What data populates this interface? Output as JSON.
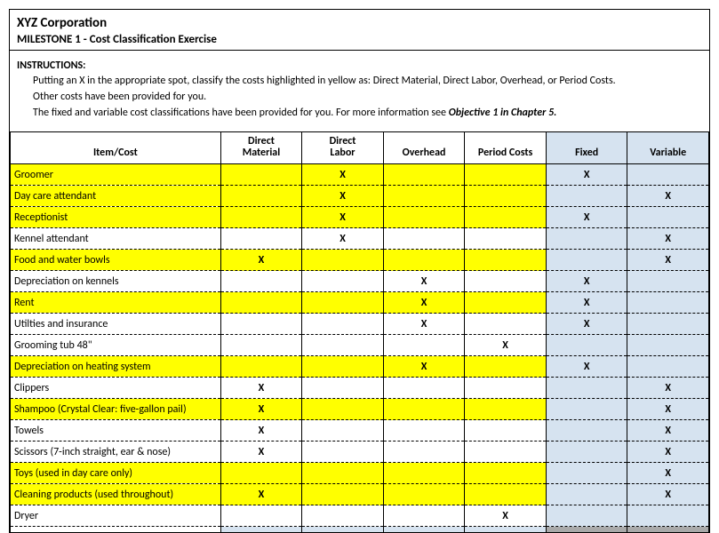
{
  "header": {
    "company": "XYZ Corporation",
    "milestone": "MILESTONE 1 - Cost Classification Exercise"
  },
  "instructions": {
    "label": "INSTRUCTIONS:",
    "line1": "Putting an X in the appropriate spot, classify the costs highlighted in yellow as:  Direct Material, Direct Labor, Overhead, or Period Costs.",
    "line2": "Other costs have been provided for you.",
    "line3a": "The fixed and variable cost classifications have been provided for you.  For more information see ",
    "line3b": "Objective 1 in Chapter 5."
  },
  "columns": {
    "item": "Item/Cost",
    "dm_l1": "Direct",
    "dm_l2": "Material",
    "dl_l1": "Direct",
    "dl_l2": "Labor",
    "oh": "Overhead",
    "pc": "Period Costs",
    "fixed": "Fixed",
    "variable": "Variable"
  },
  "rows": [
    {
      "label": "Groomer",
      "hl": true,
      "dm": "",
      "dl": "X",
      "oh": "",
      "pc": "",
      "f": "X",
      "v": ""
    },
    {
      "label": "Day care attendant",
      "hl": true,
      "dm": "",
      "dl": "X",
      "oh": "",
      "pc": "",
      "f": "",
      "v": "X"
    },
    {
      "label": "Receptionist",
      "hl": true,
      "dm": "",
      "dl": "X",
      "oh": "",
      "pc": "",
      "f": "X",
      "v": ""
    },
    {
      "label": "Kennel attendant",
      "hl": false,
      "dm": "",
      "dl": "X",
      "oh": "",
      "pc": "",
      "f": "",
      "v": "X"
    },
    {
      "label": "Food and water bowls",
      "hl": true,
      "dm": "X",
      "dl": "",
      "oh": "",
      "pc": "",
      "f": "",
      "v": "X"
    },
    {
      "label": "Depreciation on kennels",
      "hl": false,
      "dm": "",
      "dl": "",
      "oh": "X",
      "pc": "",
      "f": "X",
      "v": ""
    },
    {
      "label": "Rent",
      "hl": true,
      "dm": "",
      "dl": "",
      "oh": "X",
      "pc": "",
      "f": "X",
      "v": ""
    },
    {
      "label": "Utilties and insurance",
      "hl": false,
      "dm": "",
      "dl": "",
      "oh": "X",
      "pc": "",
      "f": "X",
      "v": ""
    },
    {
      "label": "Grooming tub 48\"",
      "hl": false,
      "dm": "",
      "dl": "",
      "oh": "",
      "pc": "X",
      "f": "",
      "v": ""
    },
    {
      "label": "Depreciation on heating system",
      "hl": true,
      "dm": "",
      "dl": "",
      "oh": "X",
      "pc": "",
      "f": "X",
      "v": ""
    },
    {
      "label": "Clippers",
      "hl": false,
      "dm": "X",
      "dl": "",
      "oh": "",
      "pc": "",
      "f": "",
      "v": "X"
    },
    {
      "label": "Shampoo (Crystal Clear: five-gallon pail)",
      "hl": true,
      "dm": "X",
      "dl": "",
      "oh": "",
      "pc": "",
      "f": "",
      "v": "X"
    },
    {
      "label": "Towels",
      "hl": false,
      "dm": "X",
      "dl": "",
      "oh": "",
      "pc": "",
      "f": "",
      "v": "X"
    },
    {
      "label": "Scissors (7-inch straight, ear & nose)",
      "hl": false,
      "dm": "X",
      "dl": "",
      "oh": "",
      "pc": "",
      "f": "",
      "v": "X"
    },
    {
      "label": "Toys (used in day care only)",
      "hl": true,
      "dm": "",
      "dl": "",
      "oh": "",
      "pc": "",
      "f": "",
      "v": "X"
    },
    {
      "label": "Cleaning products (used throughout)",
      "hl": true,
      "dm": "X",
      "dl": "",
      "oh": "",
      "pc": "",
      "f": "",
      "v": "X"
    },
    {
      "label": "Dryer",
      "hl": false,
      "dm": "",
      "dl": "",
      "oh": "",
      "pc": "X",
      "f": "",
      "v": ""
    }
  ]
}
